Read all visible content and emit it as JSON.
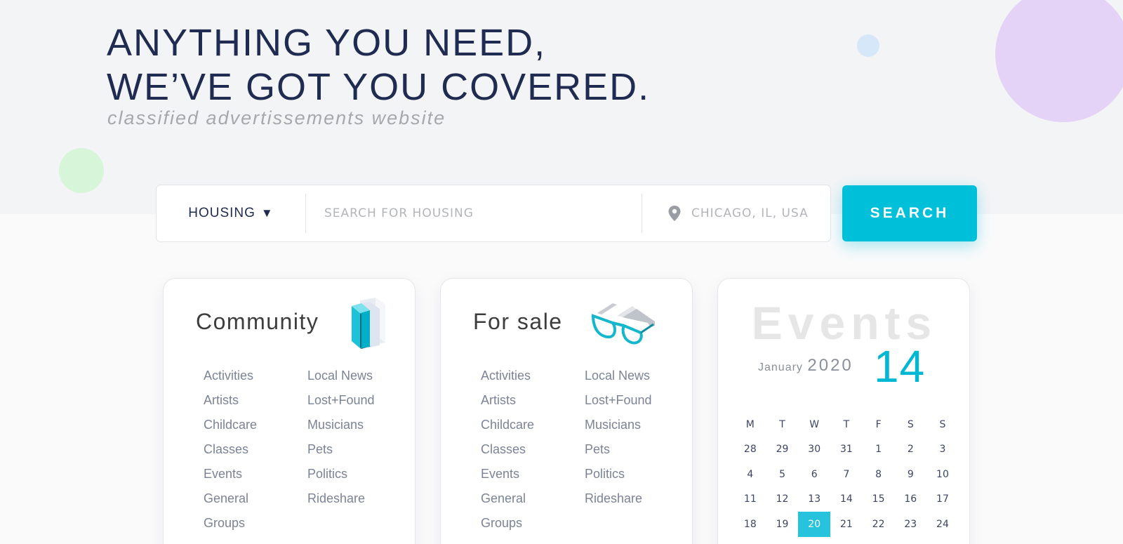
{
  "hero": {
    "headline_line1": "ANYTHING YOU NEED,",
    "headline_line2": "WE’VE GOT YOU COVERED.",
    "tagline": "classified advertissements website"
  },
  "search": {
    "category": "HOUSING",
    "caret": "▼",
    "query_placeholder": "SEARCH FOR HOUSING",
    "location_placeholder": "CHICAGO, IL, USA",
    "button_label": "SEARCH"
  },
  "community": {
    "title": "Community",
    "icon": "books-icon",
    "col1": [
      "Activities",
      "Artists",
      "Childcare",
      "Classes",
      "Events",
      "General",
      "Groups"
    ],
    "col2": [
      "Local News",
      "Lost+Found",
      "Musicians",
      "Pets",
      "Politics",
      "Rideshare"
    ]
  },
  "forsale": {
    "title": "For sale",
    "icon": "glasses-icon",
    "col1": [
      "Activities",
      "Artists",
      "Childcare",
      "Classes",
      "Events",
      "General",
      "Groups"
    ],
    "col2": [
      "Local News",
      "Lost+Found",
      "Musicians",
      "Pets",
      "Politics",
      "Rideshare"
    ]
  },
  "events": {
    "title": "Events",
    "month": "January",
    "year": "2020",
    "day": "14",
    "weekdays": [
      "M",
      "T",
      "W",
      "T",
      "F",
      "S",
      "S"
    ],
    "weeks": [
      [
        "28",
        "29",
        "30",
        "31",
        "1",
        "2",
        "3"
      ],
      [
        "4",
        "5",
        "6",
        "7",
        "8",
        "9",
        "10"
      ],
      [
        "11",
        "12",
        "13",
        "14",
        "15",
        "16",
        "17"
      ],
      [
        "18",
        "19",
        "20",
        "21",
        "22",
        "23",
        "24"
      ]
    ],
    "selected_day": "20"
  },
  "colors": {
    "accent": "#00c0d9",
    "headline": "#1f2b51",
    "selected_day": "#27c3dc"
  }
}
